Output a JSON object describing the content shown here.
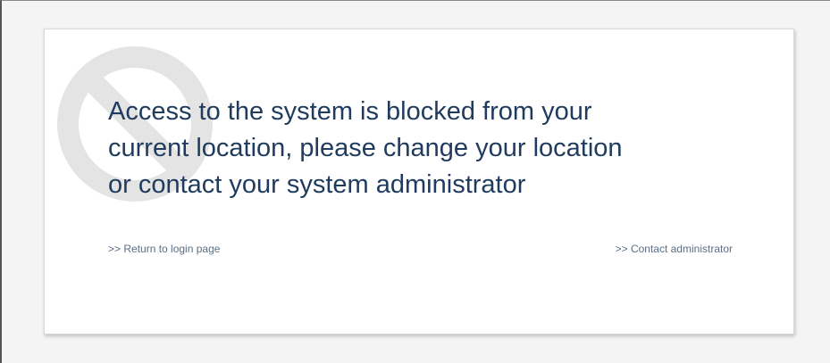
{
  "message": {
    "lines": [
      "Access to the system is blocked from your",
      "current location, please change your location",
      "or contact your system administrator"
    ]
  },
  "links": {
    "return_to_login": ">> Return to login page",
    "contact_admin": ">> Contact administrator"
  },
  "icons": {
    "background": "blocked-icon"
  },
  "colors": {
    "page_background": "#f4f4f4",
    "card_background": "#ffffff",
    "message_text": "#1f3b5e",
    "link_text": "#5a6e84",
    "icon": "#e4e4e4"
  }
}
